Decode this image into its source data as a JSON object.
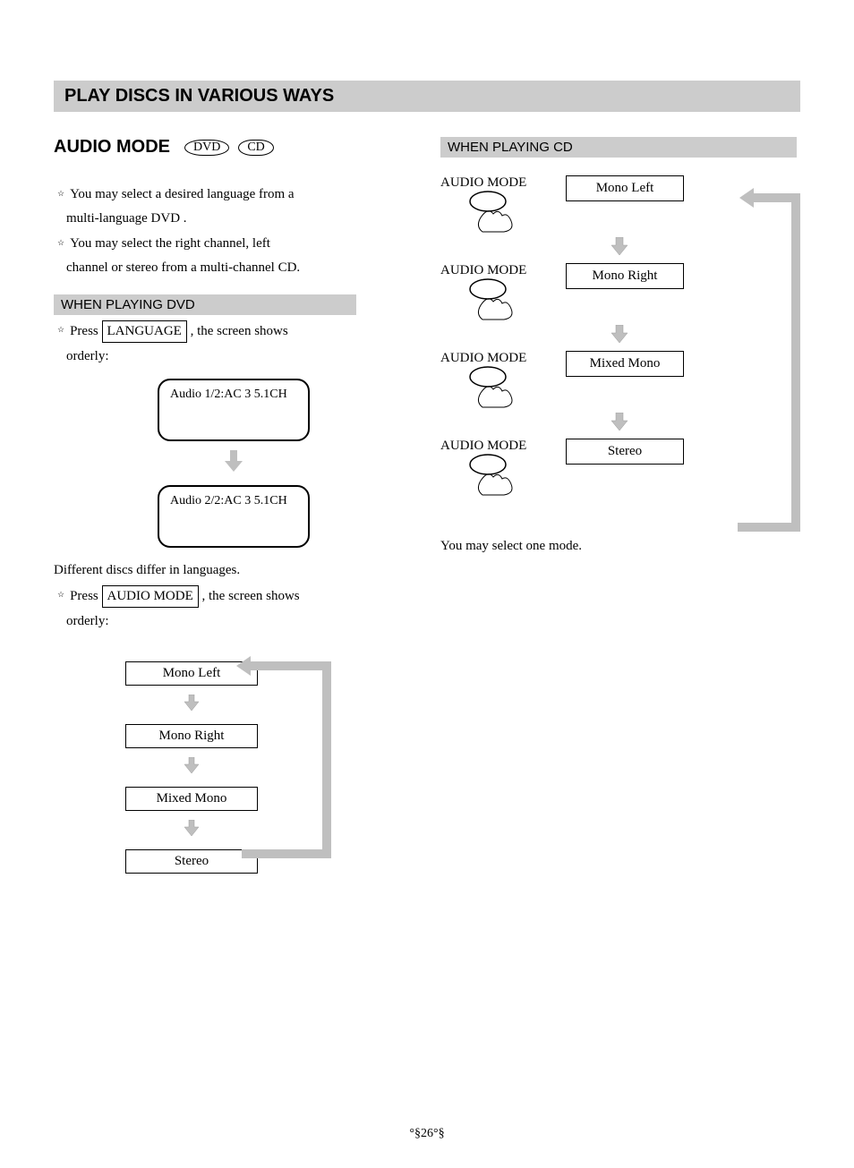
{
  "title": "PLAY DISCS IN VARIOUS WAYS",
  "section_title": "AUDIO MODE",
  "tags": {
    "dvd": "DVD",
    "cd": "CD"
  },
  "intro": {
    "line1a": "You may select a desired language from a",
    "line1b": "multi-language DVD .",
    "line2a": "You may select the right channel, left",
    "line2b": "channel or stereo from a multi-channel CD."
  },
  "dvd_section": {
    "header": "WHEN PLAYING DVD",
    "press_prefix": "Press ",
    "language_key": "LANGUAGE",
    "press_suffix": " , the screen shows",
    "orderly": "orderly:",
    "screen1": "Audio 1/2:AC 3  5.1CH",
    "screen2": "Audio 2/2:AC 3  5.1CH",
    "diff_line": "Different discs differ in languages.",
    "press2_prefix": "Press ",
    "audio_mode_key": "AUDIO MODE",
    "press2_suffix": " , the screen  shows",
    "orderly2": "orderly:",
    "modes": [
      "Mono Left",
      "Mono Right",
      "Mixed Mono",
      "Stereo"
    ]
  },
  "cd_section": {
    "header": "WHEN PLAYING CD",
    "button_label": "AUDIO MODE",
    "modes": [
      "Mono Left",
      "Mono Right",
      "Mixed Mono",
      "Stereo"
    ],
    "footer": "You may select one mode."
  },
  "page_number": "°§26°§"
}
